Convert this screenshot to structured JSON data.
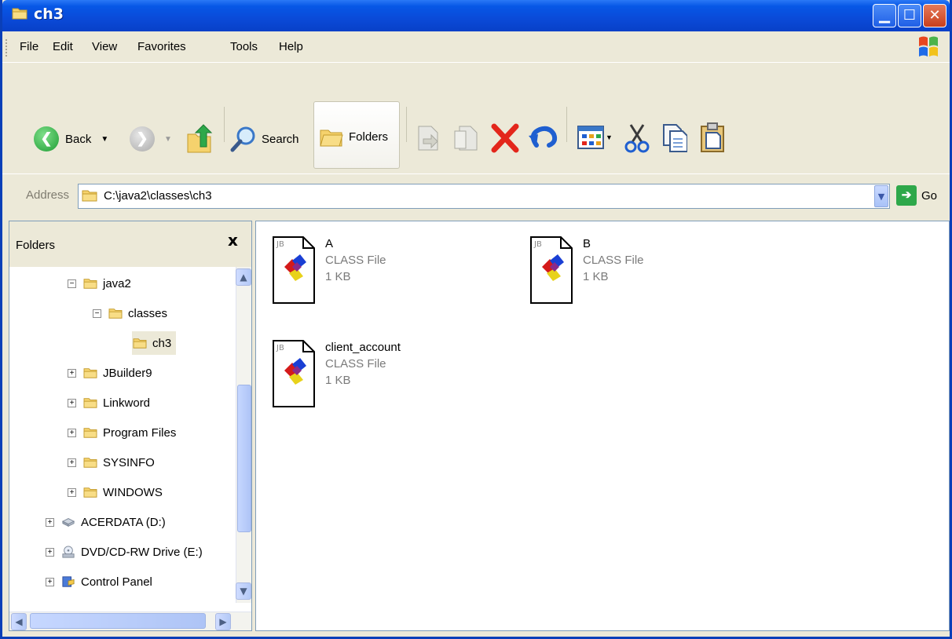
{
  "window": {
    "title": "ch3"
  },
  "menu": {
    "items": [
      "File",
      "Edit",
      "View",
      "Favorites",
      "Tools",
      "Help"
    ]
  },
  "toolbar": {
    "back_label": "Back",
    "search_label": "Search",
    "folders_label": "Folders"
  },
  "address": {
    "label": "Address",
    "value": "C:\\java2\\classes\\ch3",
    "go_label": "Go"
  },
  "folders_pane": {
    "title": "Folders",
    "close_symbol": "x",
    "tree": [
      {
        "label": "java2",
        "expander": "−"
      },
      {
        "label": "classes",
        "expander": "−"
      },
      {
        "label": "ch3",
        "expander": ""
      },
      {
        "label": "JBuilder9",
        "expander": "+"
      },
      {
        "label": "Linkword",
        "expander": "+"
      },
      {
        "label": "Program Files",
        "expander": "+"
      },
      {
        "label": "SYSINFO",
        "expander": "+"
      },
      {
        "label": "WINDOWS",
        "expander": "+"
      },
      {
        "label": "ACERDATA (D:)",
        "expander": "+"
      },
      {
        "label": "DVD/CD-RW Drive (E:)",
        "expander": "+"
      },
      {
        "label": "Control Panel",
        "expander": "+"
      }
    ]
  },
  "files": [
    {
      "name": "A",
      "type": "CLASS File",
      "size": "1 KB"
    },
    {
      "name": "B",
      "type": "CLASS File",
      "size": "1 KB"
    },
    {
      "name": "client_account",
      "type": "CLASS File",
      "size": "1 KB"
    }
  ],
  "colors": {
    "titlebar": "#0a4ad8",
    "chrome": "#ece9d8",
    "delete_x": "#e3261b",
    "folder_yellow": "#f5c94a"
  }
}
